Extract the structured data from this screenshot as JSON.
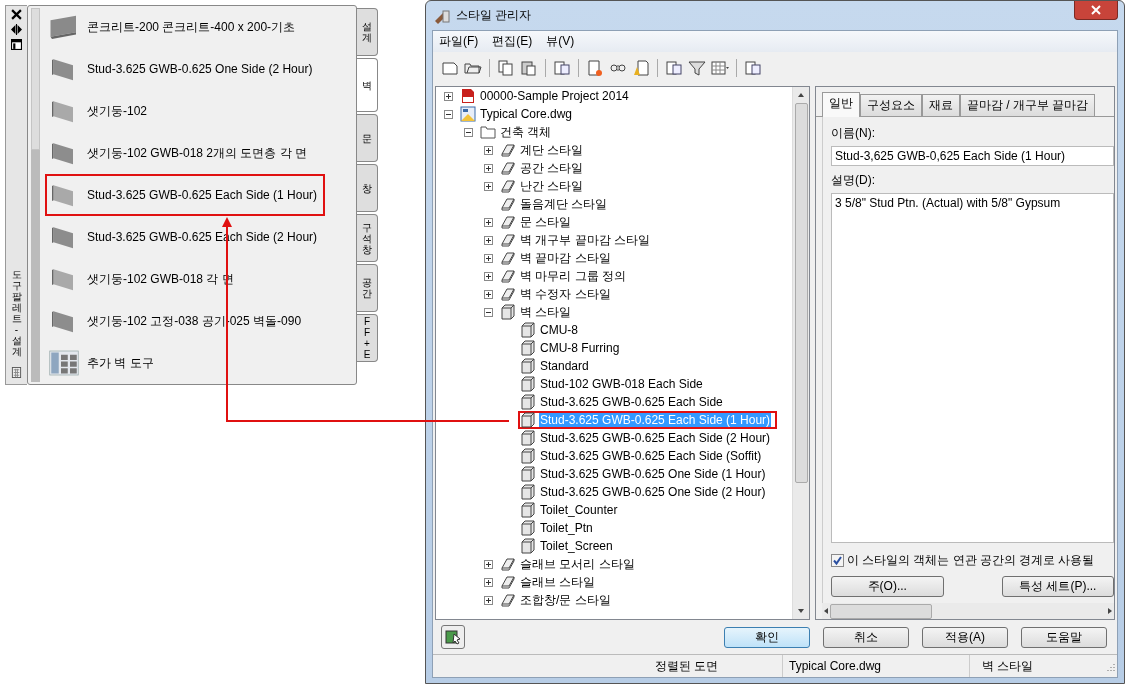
{
  "palette": {
    "title": "도구 팔레트 - 설계",
    "items": [
      {
        "label": "콘크리트-200 콘크리트-400 x 200-기초",
        "kind": "footing",
        "marked": false
      },
      {
        "label": "Stud-3.625 GWB-0.625 One Side (2 Hour)",
        "kind": "wall",
        "marked": false
      },
      {
        "label": "샛기둥-102",
        "kind": "wall",
        "marked": false
      },
      {
        "label": "샛기둥-102 GWB-018 2개의 도면층 각 면",
        "kind": "wall",
        "marked": false
      },
      {
        "label": "Stud-3.625 GWB-0.625 Each Side (1 Hour)",
        "kind": "wall",
        "marked": true
      },
      {
        "label": "Stud-3.625 GWB-0.625 Each Side (2 Hour)",
        "kind": "wall",
        "marked": false
      },
      {
        "label": "샛기둥-102 GWB-018 각 면",
        "kind": "wall",
        "marked": false
      },
      {
        "label": "샛기둥-102 고정-038 공기-025 벽돌-090",
        "kind": "wall",
        "marked": false
      },
      {
        "label": "추가 벽 도구",
        "kind": "tool",
        "marked": false
      }
    ],
    "tabs": [
      {
        "label": "설계",
        "selected": false
      },
      {
        "label": "벽",
        "selected": true
      },
      {
        "label": "문",
        "selected": false
      },
      {
        "label": "창",
        "selected": false
      },
      {
        "label": "구석창",
        "selected": false
      },
      {
        "label": "공간",
        "selected": false
      },
      {
        "label": "FF + E",
        "selected": false
      }
    ]
  },
  "window": {
    "title": "스타일 관리자"
  },
  "menu": [
    "파일(F)",
    "편집(E)",
    "뷰(V)"
  ],
  "tree": [
    {
      "label": "00000-Sample Project 2014",
      "kind": "project",
      "expanded": false,
      "selected": false
    },
    {
      "label": "Typical Core.dwg",
      "kind": "drawing",
      "expanded": true,
      "selected": false,
      "children": [
        {
          "label": "건축 객체",
          "kind": "folder",
          "expanded": true,
          "selected": false,
          "children": [
            {
              "label": "계단 스타일",
              "kind": "category",
              "expanded": false,
              "selected": false
            },
            {
              "label": "공간 스타일",
              "kind": "category",
              "expanded": false,
              "selected": false
            },
            {
              "label": "난간 스타일",
              "kind": "category",
              "expanded": false,
              "selected": false
            },
            {
              "label": "돌음계단 스타일",
              "kind": "category",
              "selected": false
            },
            {
              "label": "문 스타일",
              "kind": "category",
              "expanded": false,
              "selected": false
            },
            {
              "label": "벽 개구부 끝마감 스타일",
              "kind": "category",
              "expanded": false,
              "selected": false
            },
            {
              "label": "벽 끝마감 스타일",
              "kind": "category",
              "expanded": false,
              "selected": false
            },
            {
              "label": "벽 마무리 그룹 정의",
              "kind": "category",
              "expanded": false,
              "selected": false
            },
            {
              "label": "벽 수정자 스타일",
              "kind": "category",
              "expanded": false,
              "selected": false
            },
            {
              "label": "벽 스타일",
              "kind": "style",
              "expanded": true,
              "selected": false,
              "children": [
                {
                  "label": "CMU-8",
                  "kind": "style",
                  "selected": false
                },
                {
                  "label": "CMU-8 Furring",
                  "kind": "style",
                  "selected": false
                },
                {
                  "label": "Standard",
                  "kind": "style",
                  "selected": false
                },
                {
                  "label": "Stud-102 GWB-018 Each Side",
                  "kind": "style",
                  "selected": false
                },
                {
                  "label": "Stud-3.625 GWB-0.625 Each Side",
                  "kind": "style",
                  "selected": false
                },
                {
                  "label": "Stud-3.625 GWB-0.625 Each Side (1 Hour)",
                  "kind": "style",
                  "selected": true
                },
                {
                  "label": "Stud-3.625 GWB-0.625 Each Side (2 Hour)",
                  "kind": "style",
                  "selected": false
                },
                {
                  "label": "Stud-3.625 GWB-0.625 Each Side (Soffit)",
                  "kind": "style",
                  "selected": false
                },
                {
                  "label": "Stud-3.625 GWB-0.625 One Side (1 Hour)",
                  "kind": "style",
                  "selected": false
                },
                {
                  "label": "Stud-3.625 GWB-0.625 One Side (2 Hour)",
                  "kind": "style",
                  "selected": false
                },
                {
                  "label": "Toilet_Counter",
                  "kind": "style",
                  "selected": false
                },
                {
                  "label": "Toilet_Ptn",
                  "kind": "style",
                  "selected": false
                },
                {
                  "label": "Toilet_Screen",
                  "kind": "style",
                  "selected": false
                }
              ]
            },
            {
              "label": "슬래브 모서리 스타일",
              "kind": "category",
              "expanded": false,
              "selected": false
            },
            {
              "label": "슬래브 스타일",
              "kind": "category",
              "expanded": false,
              "selected": false
            },
            {
              "label": "조합창/문 스타일",
              "kind": "category",
              "expanded": false,
              "selected": false
            }
          ]
        }
      ]
    }
  ],
  "tabs": [
    {
      "label": "일반",
      "selected": true
    },
    {
      "label": "구성요소",
      "selected": false
    },
    {
      "label": "재료",
      "selected": false
    },
    {
      "label": "끝마감 / 개구부 끝마감",
      "selected": false
    }
  ],
  "name_label": "이름(N):",
  "name_value": "Stud-3,625 GWB-0,625 Each Side (1 Hour)",
  "description_label": "설명(D):",
  "description_value": "3 5/8\" Stud Ptn. (Actual) with 5/8\" Gypsum",
  "checkbox": {
    "label": "이 스타일의 객체는 연관 공간의 경계로 사용될",
    "checked": true
  },
  "panel_buttons": [
    "주(O)...",
    "특성 세트(P)..."
  ],
  "buttons": [
    {
      "label": "확인",
      "default": true
    },
    {
      "label": "취소",
      "default": false
    },
    {
      "label": "적용(A)",
      "default": false
    },
    {
      "label": "도움말",
      "default": false
    }
  ],
  "status_bar": [
    "정렬된 도면",
    "Typical Core.dwg",
    "벽 스타일"
  ]
}
